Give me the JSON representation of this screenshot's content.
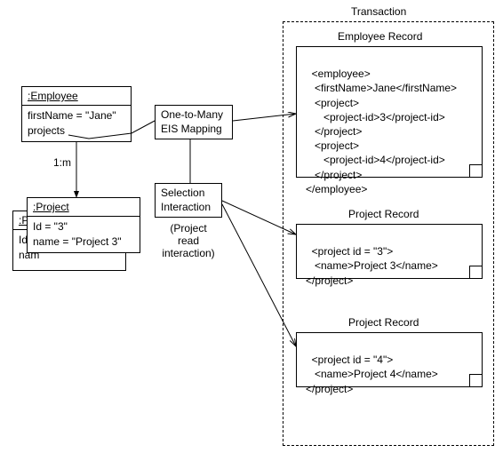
{
  "labels": {
    "transaction": "Transaction",
    "employee_record": "Employee Record",
    "project_record_1": "Project Record",
    "project_record_2": "Project Record",
    "one_to_many_l1": "One-to-Many",
    "one_to_many_l2": "EIS Mapping",
    "selection_l1": "Selection",
    "selection_l2": "Interaction",
    "project_read_l1": "(Project",
    "project_read_l2": "read",
    "project_read_l3": "interaction)",
    "multiplicity": "1:m"
  },
  "employee": {
    "title": ":Employee",
    "attr1": "firstName = \"Jane\"",
    "attr2": "projects"
  },
  "project": {
    "title": ":Project",
    "attr1": "Id = \"3\"",
    "attr2": "name = \"Project 3\""
  },
  "project_back": {
    "title": ":Pr",
    "attr1": "Id =",
    "attr2": "nam"
  },
  "records": {
    "employee": "<employee>\n   <firstName>Jane</firstName>\n   <project>\n      <project-id>3</project-id>\n   </project>\n   <project>\n      <project-id>4</project-id>\n   </project>\n</employee>",
    "project1": "<project id = \"3\">\n   <name>Project 3</name>\n</project>",
    "project2": "<project id = \"4\">\n   <name>Project 4</name>\n</project>"
  },
  "chart_data": {
    "type": "diagram",
    "description": "UML object diagram showing an Employee object with firstName 'Jane' linked 1:m to Project objects (Id 3, name 'Project 3'). A One-to-Many EIS Mapping with a Selection Interaction (Project read interaction) produces, within a Transaction, an Employee Record XML and two Project Record XML documents.",
    "objects": [
      {
        "class": "Employee",
        "attrs": {
          "firstName": "Jane",
          "projects": [
            3,
            4
          ]
        }
      },
      {
        "class": "Project",
        "attrs": {
          "Id": "3",
          "name": "Project 3"
        }
      },
      {
        "class": "Project",
        "attrs": {
          "Id": "4",
          "name": "Project 4"
        }
      }
    ],
    "relations": [
      {
        "from": "Employee",
        "to": "Project",
        "multiplicity": "1:m"
      }
    ],
    "mapping": {
      "type": "One-to-Many EIS Mapping",
      "interaction": "Selection Interaction (Project read interaction)"
    },
    "transaction_records": [
      {
        "title": "Employee Record",
        "xml": "<employee><firstName>Jane</firstName><project><project-id>3</project-id></project><project><project-id>4</project-id></project></employee>"
      },
      {
        "title": "Project Record",
        "xml": "<project id=\"3\"><name>Project 3</name></project>"
      },
      {
        "title": "Project Record",
        "xml": "<project id=\"4\"><name>Project 4</name></project>"
      }
    ]
  }
}
